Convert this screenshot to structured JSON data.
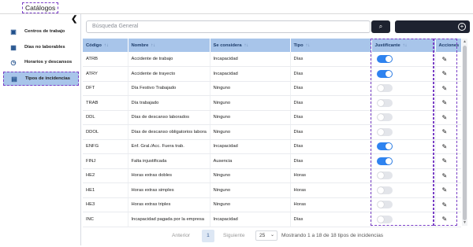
{
  "header": {
    "title": "Catálogos"
  },
  "sidebar": {
    "collapse_icon": "chevron-left-icon",
    "items": [
      {
        "label": "Centros de trabajo",
        "icon": "building-icon",
        "glyph": "▣"
      },
      {
        "label": "Días no laborables",
        "icon": "calendar-icon",
        "glyph": "▦"
      },
      {
        "label": "Horarios y descansos",
        "icon": "clock-icon",
        "glyph": "◷"
      },
      {
        "label": "Tipos de incidencias",
        "icon": "grid-icon",
        "glyph": "▤",
        "active": true
      }
    ]
  },
  "search": {
    "placeholder": "Búsqueda General",
    "button_icon": "search-icon",
    "button_glyph": "⌕",
    "add_icon": "plus-circle-icon",
    "add_glyph": "+"
  },
  "table": {
    "columns": [
      "Código",
      "Nombre",
      "Se considera",
      "Tipo",
      "Justificante",
      "Acciones"
    ],
    "sort_glyph": "↑↓",
    "edit_glyph": "✎",
    "rows": [
      {
        "code": "ATRB",
        "name": "Accidente de trabajo",
        "considered": "Incapacidad",
        "type": "Días",
        "justificante": true
      },
      {
        "code": "ATRY",
        "name": "Accidente de trayecto",
        "considered": "Incapacidad",
        "type": "Días",
        "justificante": true
      },
      {
        "code": "DFT",
        "name": "Día Festivo Trabajado",
        "considered": "Ninguno",
        "type": "Días",
        "justificante": false
      },
      {
        "code": "TRAB",
        "name": "Día trabajado",
        "considered": "Ninguno",
        "type": "Días",
        "justificante": false
      },
      {
        "code": "DDL",
        "name": "Días de descanso laborados",
        "considered": "Ninguno",
        "type": "Días",
        "justificante": false
      },
      {
        "code": "DDOL",
        "name": "Días de descanso obligatorios labora",
        "considered": "Ninguno",
        "type": "Días",
        "justificante": false
      },
      {
        "code": "ENFG",
        "name": "Enf. Gral./Acc. Fuera trab.",
        "considered": "Incapacidad",
        "type": "Días",
        "justificante": true
      },
      {
        "code": "FINJ",
        "name": "Falta injustificada",
        "considered": "Ausencia",
        "type": "Días",
        "justificante": true
      },
      {
        "code": "HE2",
        "name": "Horas extras dobles",
        "considered": "Ninguno",
        "type": "Horas",
        "justificante": false
      },
      {
        "code": "HE1",
        "name": "Horas extras simples",
        "considered": "Ninguno",
        "type": "Horas",
        "justificante": false
      },
      {
        "code": "HE3",
        "name": "Horas extras triples",
        "considered": "Ninguno",
        "type": "Horas",
        "justificante": false
      },
      {
        "code": "INC",
        "name": "Incapacidad pagada por la empresa",
        "considered": "Incapacidad",
        "type": "Días",
        "justificante": false
      }
    ]
  },
  "pagination": {
    "prev_label": "Anterior",
    "current_page": "1",
    "next_label": "Siguiente",
    "page_size": "25",
    "summary": "Mostrando 1 a 18 de 18 tipos de incidencias"
  },
  "colors": {
    "accent": "#2e83f0",
    "header_bg": "#a8c5ea",
    "dark_button": "#1e2230",
    "highlight_outline": "#7a3fc6"
  }
}
